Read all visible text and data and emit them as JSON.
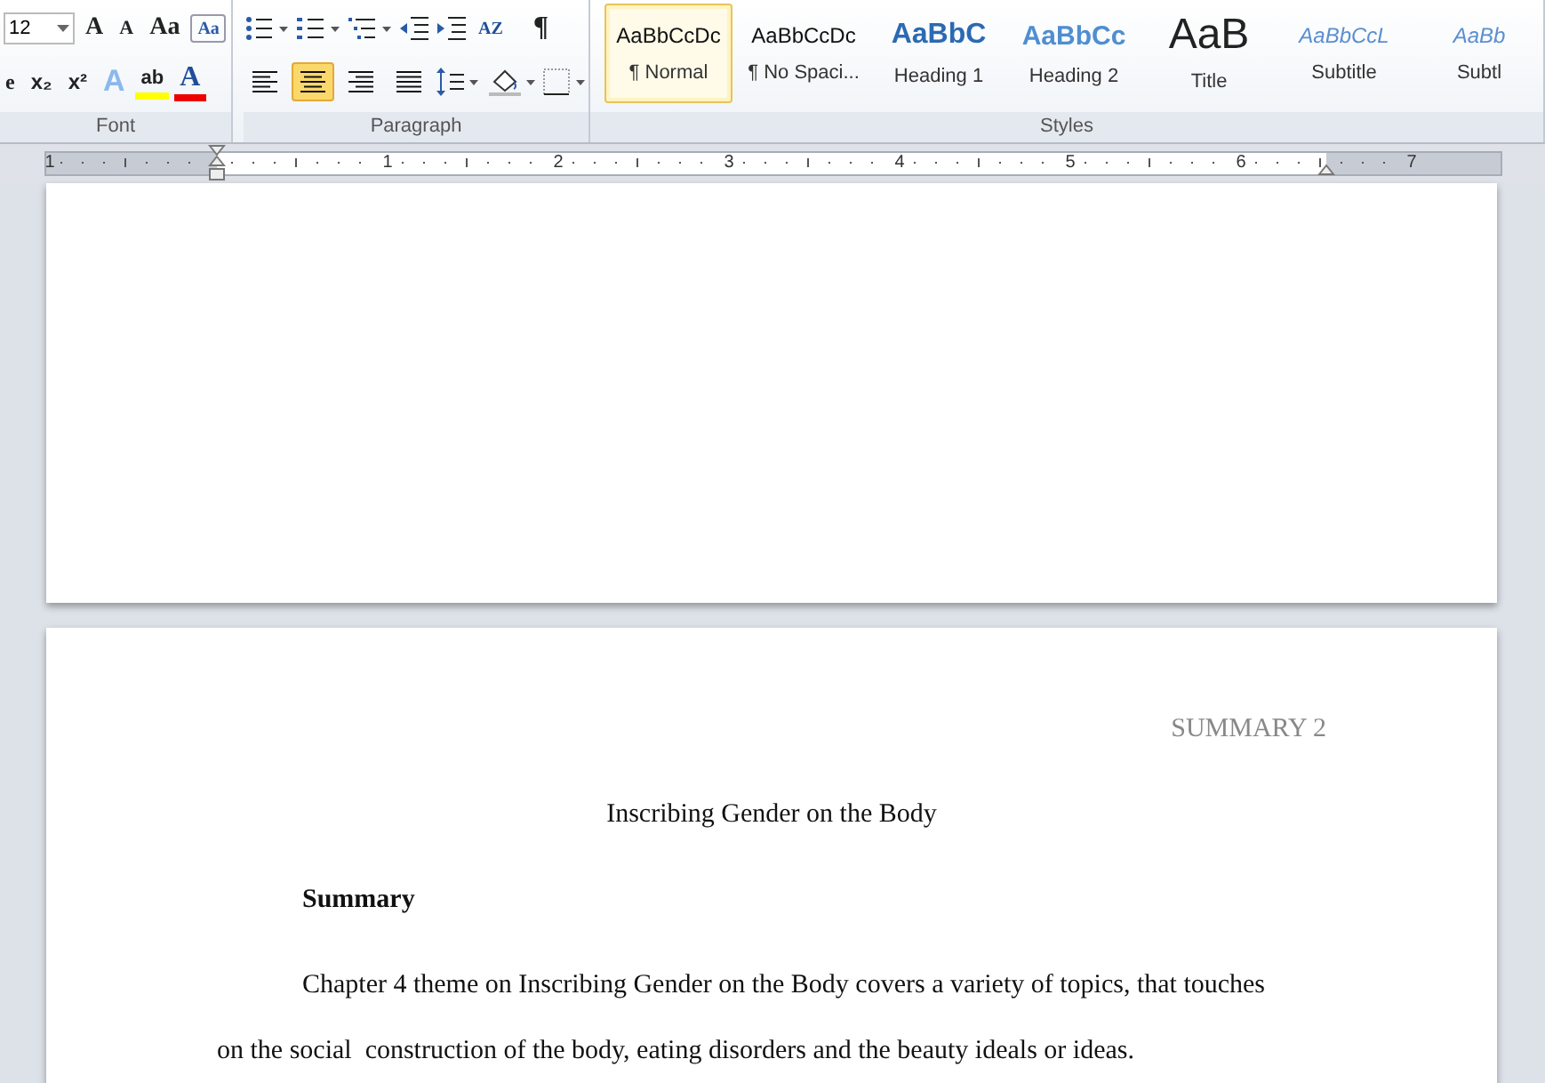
{
  "ribbon": {
    "font_group": {
      "label": "Font",
      "font_size": "12",
      "row1": [
        {
          "kind": "grow",
          "glyph": "A"
        },
        {
          "kind": "shrink",
          "glyph": "A"
        },
        {
          "kind": "case",
          "glyph": "Aa"
        },
        {
          "kind": "clear",
          "glyph": "Aa"
        }
      ],
      "row2": [
        {
          "kind": "partial",
          "glyph": "e"
        },
        {
          "kind": "sub",
          "glyph": "x₂"
        },
        {
          "kind": "sup",
          "glyph": "x²"
        },
        {
          "kind": "effects",
          "glyph": "A"
        },
        {
          "kind": "highlight",
          "glyph": "ab"
        },
        {
          "kind": "color",
          "glyph": "A"
        }
      ]
    },
    "paragraph_group": {
      "label": "Paragraph",
      "pilcrow": "¶",
      "sort": "AZ",
      "alignment": [
        {
          "kind": "left",
          "selected": false
        },
        {
          "kind": "center",
          "selected": true
        },
        {
          "kind": "right",
          "selected": false
        },
        {
          "kind": "justify",
          "selected": false
        }
      ]
    },
    "styles_group": {
      "label": "Styles",
      "items": [
        {
          "kind": "normal",
          "sample": "AaBbCcDc",
          "label": "¶ Normal",
          "selected": true
        },
        {
          "kind": "nospacing",
          "sample": "AaBbCcDc",
          "label": "¶ No Spaci...",
          "selected": false
        },
        {
          "kind": "heading1",
          "sample": "AaBbC",
          "label": "Heading 1",
          "selected": false
        },
        {
          "kind": "heading2",
          "sample": "AaBbCc",
          "label": "Heading 2",
          "selected": false
        },
        {
          "kind": "title",
          "sample": "AaB",
          "label": "Title",
          "selected": false
        },
        {
          "kind": "subtitle",
          "sample": "AaBbCcL",
          "label": "Subtitle",
          "selected": false
        },
        {
          "kind": "subtle",
          "sample": "AaBb",
          "label": "Subtl",
          "selected": false
        }
      ]
    }
  },
  "ruler": {
    "numbers": [
      "1",
      "1",
      "2",
      "3",
      "4",
      "5",
      "6",
      "7"
    ]
  },
  "page2": {
    "header": "SUMMARY 2",
    "title": "Inscribing Gender on the Body",
    "heading": "Summary",
    "paragraph": "Chapter 4 theme on Inscribing Gender on the Body covers a variety of topics, that touches on the social  construction of the body, eating disorders and the beauty ideals or ideas."
  }
}
